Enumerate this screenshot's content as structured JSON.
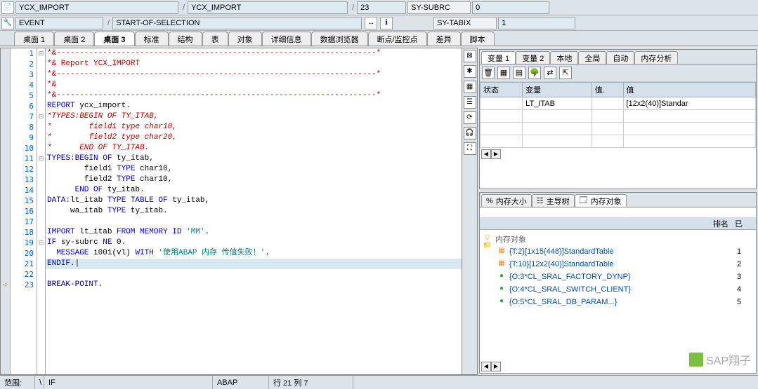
{
  "header": {
    "program1": "YCX_IMPORT",
    "program2": "YCX_IMPORT",
    "posnum": "23",
    "sy_subrc_label": "SY-SUBRC",
    "sy_subrc_val": "0",
    "event_label": "EVENT",
    "event_val": "START-OF-SELECTION",
    "sy_tabix_label": "SY-TABIX",
    "sy_tabix_val": "1"
  },
  "tabs": {
    "main": [
      "桌面 1",
      "桌面 2",
      "桌面 3",
      "标准",
      "结构",
      "表",
      "对象",
      "详细信息",
      "数据浏览器",
      "断点/监控点",
      "差异",
      "脚本"
    ],
    "active": 2
  },
  "code": {
    "lines": [
      {
        "n": 1,
        "fold": "⊟",
        "cls": "c-red",
        "txt": "*&---------------------------------------------------------------------*"
      },
      {
        "n": 2,
        "cls": "c-red",
        "txt": "*& Report YCX_IMPORT"
      },
      {
        "n": 3,
        "cls": "c-red",
        "txt": "*&---------------------------------------------------------------------*"
      },
      {
        "n": 4,
        "cls": "c-red",
        "txt": "*&"
      },
      {
        "n": 5,
        "cls": "c-red",
        "txt": "*&---------------------------------------------------------------------*"
      },
      {
        "n": 6,
        "cls": "",
        "txt": "",
        "frag": [
          {
            "c": "c-blue",
            "t": "REPORT "
          },
          {
            "c": "",
            "t": "ycx_import."
          }
        ]
      },
      {
        "n": 7,
        "fold": "⊟",
        "cls": "c-red i",
        "txt": "*TYPES:BEGIN OF TY_ITAB,"
      },
      {
        "n": 8,
        "cls": "c-red i",
        "txt": "*        field1 type char10,"
      },
      {
        "n": 9,
        "cls": "c-red i",
        "txt": "*        field2 type char20,"
      },
      {
        "n": 10,
        "cls": "c-red i",
        "txt": "*      END OF TY_ITAB."
      },
      {
        "n": 11,
        "fold": "⊟",
        "frag": [
          {
            "c": "c-blue",
            "t": "TYPES:BEGIN OF "
          },
          {
            "c": "",
            "t": "ty_itab,"
          }
        ]
      },
      {
        "n": 12,
        "frag": [
          {
            "c": "",
            "t": "        field1 "
          },
          {
            "c": "c-blue",
            "t": "TYPE "
          },
          {
            "c": "",
            "t": "char10,"
          }
        ]
      },
      {
        "n": 13,
        "frag": [
          {
            "c": "",
            "t": "        field2 "
          },
          {
            "c": "c-blue",
            "t": "TYPE "
          },
          {
            "c": "",
            "t": "char10,"
          }
        ]
      },
      {
        "n": 14,
        "frag": [
          {
            "c": "c-blue",
            "t": "      END OF "
          },
          {
            "c": "",
            "t": "ty_itab."
          }
        ]
      },
      {
        "n": 15,
        "frag": [
          {
            "c": "c-blue",
            "t": "DATA:"
          },
          {
            "c": "",
            "t": "lt_itab "
          },
          {
            "c": "c-blue",
            "t": "TYPE TABLE OF "
          },
          {
            "c": "",
            "t": "ty_itab,"
          }
        ]
      },
      {
        "n": 16,
        "frag": [
          {
            "c": "",
            "t": "     wa_itab "
          },
          {
            "c": "c-blue",
            "t": "TYPE "
          },
          {
            "c": "",
            "t": "ty_itab."
          }
        ]
      },
      {
        "n": 17,
        "txt": ""
      },
      {
        "n": 18,
        "frag": [
          {
            "c": "c-blue",
            "t": "IMPORT "
          },
          {
            "c": "",
            "t": "lt_itab "
          },
          {
            "c": "c-blue",
            "t": "FROM MEMORY ID "
          },
          {
            "c": "c-str",
            "t": "'MM'"
          },
          {
            "c": "",
            "t": "."
          }
        ]
      },
      {
        "n": 19,
        "fold": "⊟",
        "frag": [
          {
            "c": "c-blue",
            "t": "IF "
          },
          {
            "c": "",
            "t": "sy-subrc "
          },
          {
            "c": "c-blue",
            "t": "NE "
          },
          {
            "c": "",
            "t": "0."
          }
        ]
      },
      {
        "n": 20,
        "frag": [
          {
            "c": "c-blue",
            "t": "  MESSAGE "
          },
          {
            "c": "",
            "t": "i001(vl) "
          },
          {
            "c": "c-blue",
            "t": "WITH "
          },
          {
            "c": "c-str",
            "t": "'使用ABAP 内存 传值失败！'"
          },
          {
            "c": "",
            "t": "."
          }
        ]
      },
      {
        "n": 21,
        "hl": true,
        "frag": [
          {
            "c": "c-blue",
            "t": "ENDIF."
          },
          {
            "c": "",
            "t": "|"
          }
        ]
      },
      {
        "n": 22,
        "txt": ""
      },
      {
        "n": 23,
        "bp": true,
        "frag": [
          {
            "c": "c-navy",
            "t": "BREAK-POINT"
          },
          {
            "c": "",
            "t": "."
          }
        ]
      }
    ]
  },
  "side_buttons": [
    "⊠",
    "✱",
    "▦",
    "☰",
    "⟳",
    "🎧",
    "⛶"
  ],
  "vars": {
    "tabs": [
      "变量 1",
      "变量 2",
      "本地",
      "全局",
      "自动",
      "内存分析"
    ],
    "active": 0,
    "toolbar_icons": [
      "trash-icon",
      "grid-icon",
      "grid2-icon",
      "tree-icon",
      "link-icon",
      "export-icon"
    ],
    "cols": [
      "状态",
      "变量",
      "值.",
      "值"
    ],
    "rows": [
      {
        "status": "",
        "name": "LT_ITAB",
        "vd": "",
        "value": "[12x2(40)]Standar"
      }
    ]
  },
  "mem": {
    "tabs": [
      {
        "icon": "%",
        "label": "内存大小"
      },
      {
        "icon": "☷",
        "label": "主导树"
      },
      {
        "icon": "🗔",
        "label": "内存对象",
        "active": true
      }
    ],
    "header": {
      "col1": "",
      "col2": "排名",
      "col3": "已"
    },
    "root": "内存对象",
    "items": [
      {
        "icon": "table-icon",
        "label": "{T:2}[1x15(448)]StandardTable",
        "rank": "1"
      },
      {
        "icon": "table-icon",
        "label": "{T:10}[12x2(40)]StandardTable",
        "rank": "2"
      },
      {
        "icon": "obj-icon",
        "label": "{O:3*CL_SRAL_FACTORY_DYNP}",
        "rank": "3"
      },
      {
        "icon": "obj-icon",
        "label": "{O:4*CL_SRAL_SWITCH_CLIENT}",
        "rank": "4"
      },
      {
        "icon": "obj-icon",
        "label": "{O:5*CL_SRAL_DB_PARAM...}",
        "rank": "5"
      }
    ]
  },
  "status": {
    "scope_label": "范围:",
    "scope_sep": "\\",
    "scope_val": "IF",
    "lang": "ABAP",
    "pos": "行 21 列   7"
  },
  "watermark": "SAP翔子"
}
